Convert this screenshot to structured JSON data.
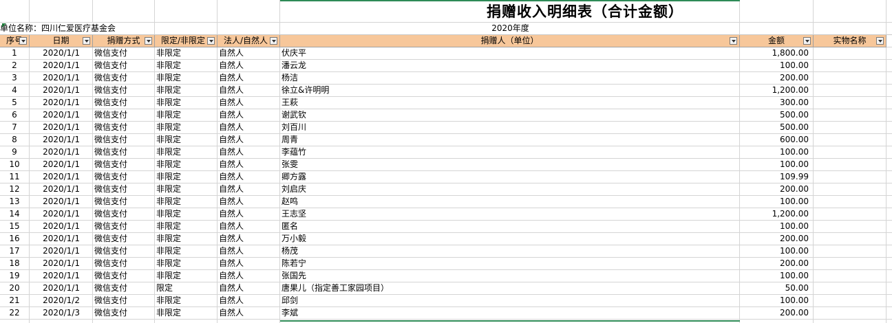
{
  "title": "捐赠收入明细表（合计金额）",
  "org_label": "单位名称：四川仁爱医疗基金会",
  "year_label": "2020年度",
  "headers": {
    "seq": "序号",
    "date": "日期",
    "method": "捐赠方式",
    "limit": "限定/非限定",
    "type": "法人/自然人",
    "donor": "捐赠人（单位）",
    "amount": "金额",
    "item": "实物名称"
  },
  "rows": [
    {
      "seq": "1",
      "date": "2020/1/1",
      "method": "微信支付",
      "limit": "非限定",
      "type": "自然人",
      "donor": "伏庆平",
      "amount": "1,800.00"
    },
    {
      "seq": "2",
      "date": "2020/1/1",
      "method": "微信支付",
      "limit": "非限定",
      "type": "自然人",
      "donor": "潘云龙",
      "amount": "100.00"
    },
    {
      "seq": "3",
      "date": "2020/1/1",
      "method": "微信支付",
      "limit": "非限定",
      "type": "自然人",
      "donor": "杨洁",
      "amount": "200.00"
    },
    {
      "seq": "4",
      "date": "2020/1/1",
      "method": "微信支付",
      "limit": "非限定",
      "type": "自然人",
      "donor": "徐立&许明明",
      "amount": "1,200.00"
    },
    {
      "seq": "5",
      "date": "2020/1/1",
      "method": "微信支付",
      "limit": "非限定",
      "type": "自然人",
      "donor": "王萩",
      "amount": "300.00"
    },
    {
      "seq": "6",
      "date": "2020/1/1",
      "method": "微信支付",
      "limit": "非限定",
      "type": "自然人",
      "donor": "谢武钦",
      "amount": "500.00"
    },
    {
      "seq": "7",
      "date": "2020/1/1",
      "method": "微信支付",
      "limit": "非限定",
      "type": "自然人",
      "donor": "刘百川",
      "amount": "500.00"
    },
    {
      "seq": "8",
      "date": "2020/1/1",
      "method": "微信支付",
      "limit": "非限定",
      "type": "自然人",
      "donor": "周青",
      "amount": "600.00"
    },
    {
      "seq": "9",
      "date": "2020/1/1",
      "method": "微信支付",
      "limit": "非限定",
      "type": "自然人",
      "donor": "李蕴竹",
      "amount": "100.00"
    },
    {
      "seq": "10",
      "date": "2020/1/1",
      "method": "微信支付",
      "limit": "非限定",
      "type": "自然人",
      "donor": "张雯",
      "amount": "100.00"
    },
    {
      "seq": "11",
      "date": "2020/1/1",
      "method": "微信支付",
      "limit": "非限定",
      "type": "自然人",
      "donor": "卿方露",
      "amount": "109.99"
    },
    {
      "seq": "12",
      "date": "2020/1/1",
      "method": "微信支付",
      "limit": "非限定",
      "type": "自然人",
      "donor": "刘启庆",
      "amount": "200.00"
    },
    {
      "seq": "13",
      "date": "2020/1/1",
      "method": "微信支付",
      "limit": "非限定",
      "type": "自然人",
      "donor": "赵鸣",
      "amount": "100.00"
    },
    {
      "seq": "14",
      "date": "2020/1/1",
      "method": "微信支付",
      "limit": "非限定",
      "type": "自然人",
      "donor": "王志坚",
      "amount": "1,200.00"
    },
    {
      "seq": "15",
      "date": "2020/1/1",
      "method": "微信支付",
      "limit": "非限定",
      "type": "自然人",
      "donor": "匿名",
      "amount": "100.00"
    },
    {
      "seq": "16",
      "date": "2020/1/1",
      "method": "微信支付",
      "limit": "非限定",
      "type": "自然人",
      "donor": "万小毅",
      "amount": "200.00"
    },
    {
      "seq": "17",
      "date": "2020/1/1",
      "method": "微信支付",
      "limit": "非限定",
      "type": "自然人",
      "donor": "杨茂",
      "amount": "100.00"
    },
    {
      "seq": "18",
      "date": "2020/1/1",
      "method": "微信支付",
      "limit": "非限定",
      "type": "自然人",
      "donor": "陈若宁",
      "amount": "200.00"
    },
    {
      "seq": "19",
      "date": "2020/1/1",
      "method": "微信支付",
      "limit": "非限定",
      "type": "自然人",
      "donor": "张国先",
      "amount": "100.00"
    },
    {
      "seq": "20",
      "date": "2020/1/1",
      "method": "微信支付",
      "limit": "限定",
      "type": "自然人",
      "donor": "唐果儿（指定善工家园项目）",
      "amount": "50.00"
    },
    {
      "seq": "21",
      "date": "2020/1/2",
      "method": "微信支付",
      "limit": "非限定",
      "type": "自然人",
      "donor": "邱剑",
      "amount": "100.00"
    },
    {
      "seq": "22",
      "date": "2020/1/3",
      "method": "微信支付",
      "limit": "非限定",
      "type": "自然人",
      "donor": "李斌",
      "amount": "200.00"
    }
  ]
}
